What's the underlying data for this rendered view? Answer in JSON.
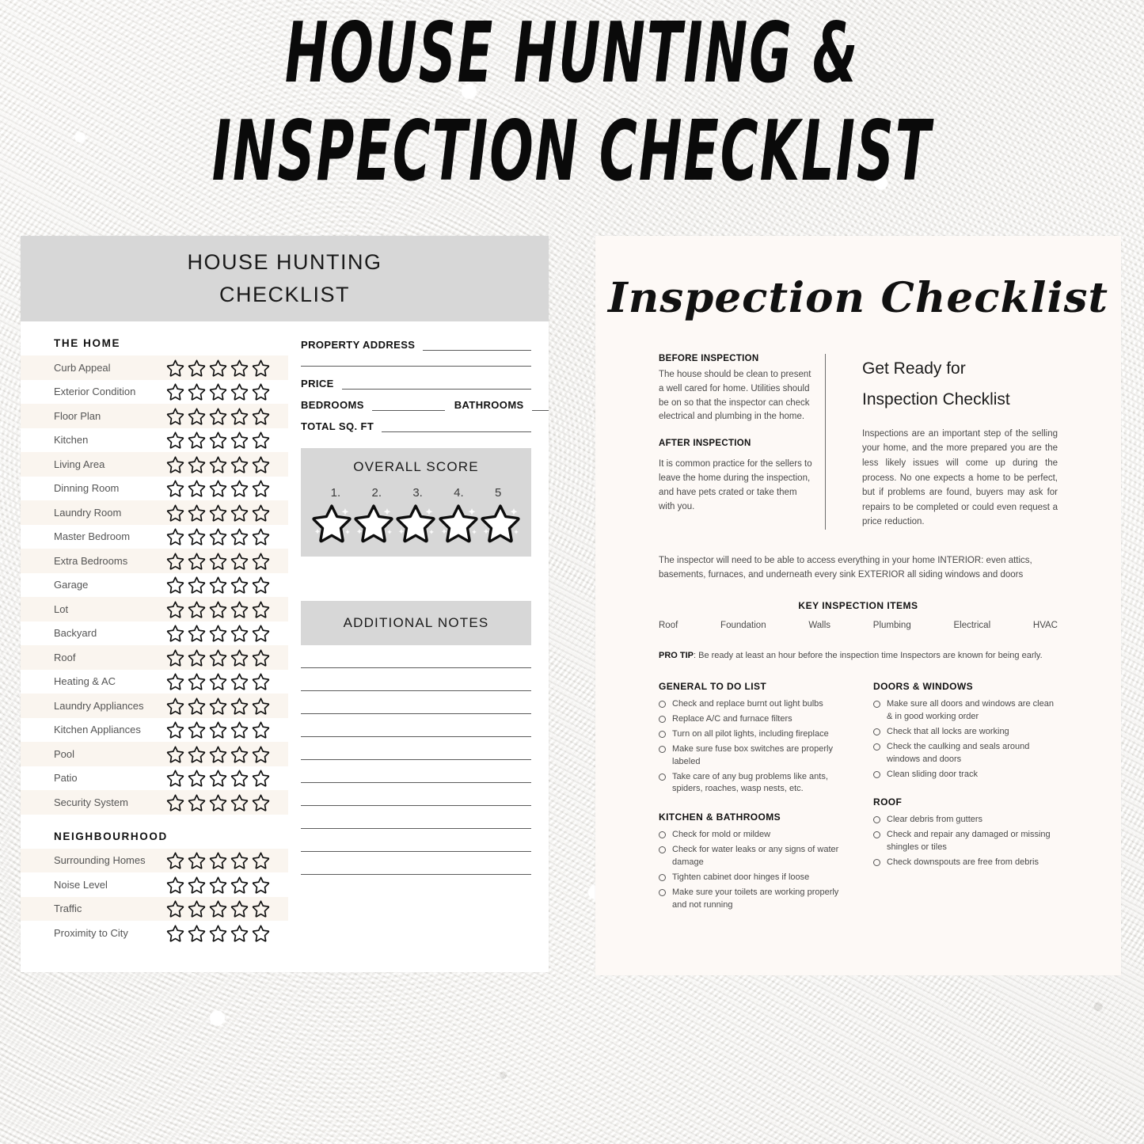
{
  "main_title": {
    "line1": "HOUSE HUNTING &",
    "line2": "INSPECTION CHECKLIST"
  },
  "hunting": {
    "header_line1": "HOUSE HUNTING",
    "header_line2": "CHECKLIST",
    "home_section_title": "THE  HOME",
    "home_items": [
      "Curb Appeal",
      "Exterior Condition",
      "Floor Plan",
      "Kitchen",
      "Living Area",
      "Dinning Room",
      "Laundry Room",
      "Master Bedroom",
      "Extra Bedrooms",
      "Garage",
      "Lot",
      "Backyard",
      "Roof",
      "Heating & AC",
      "Laundry Appliances",
      "Kitchen Appliances",
      "Pool",
      "Patio",
      "Security System"
    ],
    "neighbourhood_section_title": "NEIGHBOURHOOD",
    "neighbourhood_items": [
      "Surrounding Homes",
      "Noise Level",
      "Traffic",
      "Proximity to City"
    ],
    "stars_per_row": 5,
    "form": {
      "property_address": "PROPERTY ADDRESS",
      "price": "PRICE",
      "bedrooms": "BEDROOMS",
      "bathrooms": "BATHROOMS",
      "total_sq_ft": "TOTAL SQ. FT"
    },
    "overall_score": {
      "title": "OVERALL  SCORE",
      "numbers": [
        "1.",
        "2.",
        "3.",
        "4.",
        "5"
      ]
    },
    "additional_notes": {
      "title": "ADDITIONAL NOTES",
      "line_count": 10
    }
  },
  "inspection": {
    "title": "Inspection Checklist",
    "before_inspection": {
      "heading": "BEFORE INSPECTION",
      "body": "The house should be clean to present a well cared for home. Utilities should be on so that the inspector can check electrical and plumbing in the home."
    },
    "after_inspection": {
      "heading": "AFTER INSPECTION",
      "body": "It is common practice for the sellers to leave the home during the inspection, and have pets crated or take them with you."
    },
    "get_ready": {
      "title_line1": "Get Ready for",
      "title_line2": "Inspection Checklist",
      "body": "Inspections are an important step of the selling your home, and the more prepared you are the less likely issues will come up during the process. No one expects a home to be perfect, but if problems are found, buyers may ask for repairs to be completed or could even request a price reduction."
    },
    "access_note": "The inspector will need to be able to access everything in your home INTERIOR: even attics, basements, furnaces, and underneath every sink EXTERIOR all siding windows and doors",
    "key_inspection_items": {
      "heading": "KEY INSPECTION ITEMS",
      "items": [
        "Roof",
        "Foundation",
        "Walls",
        "Plumbing",
        "Electrical",
        "HVAC"
      ]
    },
    "pro_tip": {
      "label": "PRO TIP",
      "text": ": Be ready at least an hour before the inspection time Inspectors are known for being early."
    },
    "columns": [
      {
        "sections": [
          {
            "heading": "GENERAL TO DO LIST",
            "items": [
              "Check and replace burnt out light bulbs",
              "Replace A/C and furnace filters",
              "Turn on all pilot lights, including fireplace",
              "Make sure fuse box switches are properly labeled",
              "Take care of any bug problems like ants, spiders, roaches, wasp nests, etc."
            ]
          },
          {
            "heading": "KITCHEN & BATHROOMS",
            "items": [
              "Check for mold or mildew",
              "Check for water leaks or any signs of water damage",
              "Tighten cabinet door hinges if loose",
              "Make sure your toilets are working properly and not running"
            ]
          }
        ]
      },
      {
        "sections": [
          {
            "heading": "DOORS & WINDOWS",
            "items": [
              "Make sure all doors and windows are clean & in good working order",
              "Check that all locks are working",
              "Check the caulking and seals around windows and doors",
              "Clean sliding door track"
            ]
          },
          {
            "heading": "ROOF",
            "items": [
              "Clear debris from gutters",
              "Check and repair any damaged or missing shingles or tiles",
              "Check downspouts are free from debris"
            ]
          }
        ]
      }
    ]
  },
  "colors": {
    "background": "#e9e7e3",
    "gray_band": "#d7d7d7",
    "page_white": "#ffffff",
    "page_cream": "#fdf9f6",
    "row_alt": "#faf5ef",
    "rule": "#5b5b5b",
    "text_dark": "#111111",
    "text_muted": "#4a4a4a"
  }
}
